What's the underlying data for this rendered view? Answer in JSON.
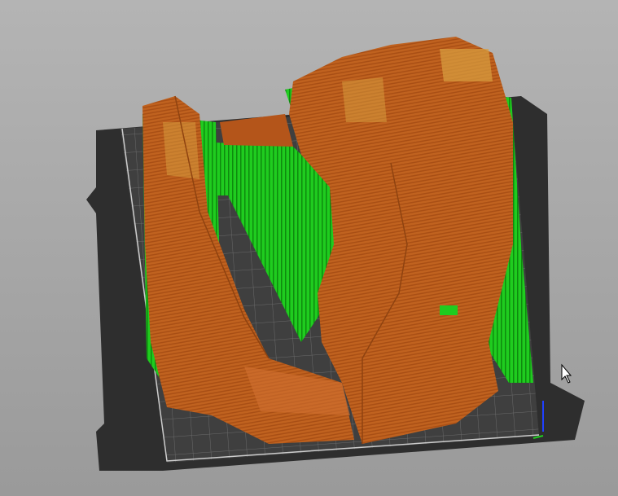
{
  "viewport": {
    "background": "#a8a8a8",
    "bed_color": "#2e2e2e",
    "grid_color": "#4a4a4a",
    "model_color": "#c0621f",
    "model_highlight": "#d8a040",
    "support_color": "#1fcc1f",
    "cursor_icon": "arrow-cursor-icon"
  }
}
